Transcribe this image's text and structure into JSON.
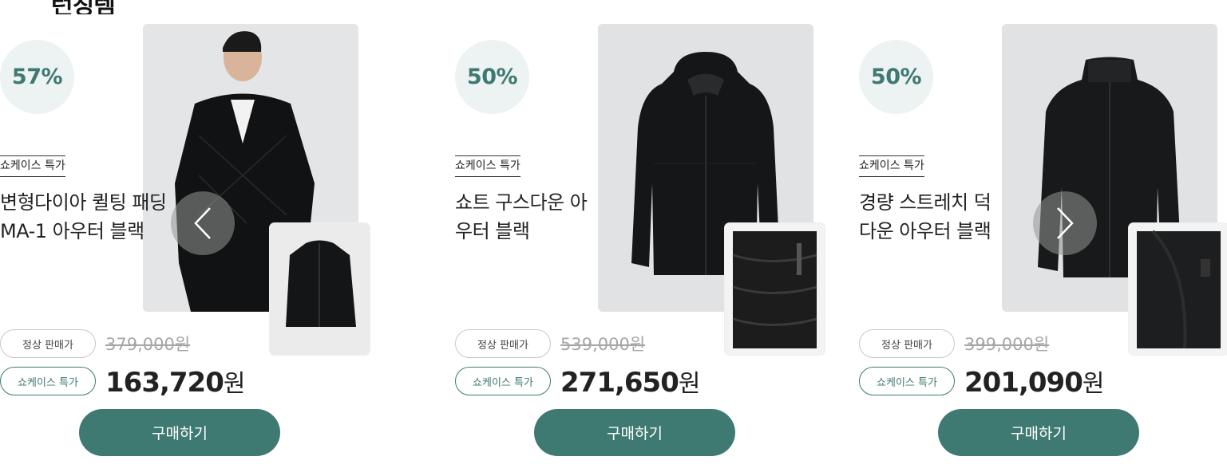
{
  "section": {
    "title": "런칭템"
  },
  "products": [
    {
      "discount": "50%",
      "promo_tag": "쇼케이스 특가",
      "name": "쇼트 구스다운 아우터 블랙",
      "regular_label": "정상 판매가",
      "regular_price": "539,000원",
      "sale_label": "쇼케이스 특가",
      "sale_price_number": "271,650",
      "sale_price_unit": "원",
      "buy_label": "구매하기"
    },
    {
      "discount": "50%",
      "promo_tag": "쇼케이스 특가",
      "name": "경량 스트레치 덕다운 아우터 블랙",
      "regular_label": "정상 판매가",
      "regular_price": "399,000원",
      "sale_label": "쇼케이스 특가",
      "sale_price_number": "201,090",
      "sale_price_unit": "원",
      "buy_label": "구매하기"
    },
    {
      "discount": "57%",
      "promo_tag": "쇼케이스 특가",
      "name": "변형다이아 퀼팅 패딩 MA-1 아우터 블랙",
      "regular_label": "정상 판매가",
      "regular_price": "379,000원",
      "sale_label": "쇼케이스 특가",
      "sale_price_number": "163,720",
      "sale_price_unit": "원",
      "buy_label": "구매하기"
    }
  ],
  "navigation": {
    "prev_icon": "chevron-left-icon",
    "next_icon": "chevron-right-icon"
  },
  "colors": {
    "accent": "#3f7a72",
    "badge_bg": "#edf2f3",
    "photo_bg": "#e1e2e3"
  }
}
